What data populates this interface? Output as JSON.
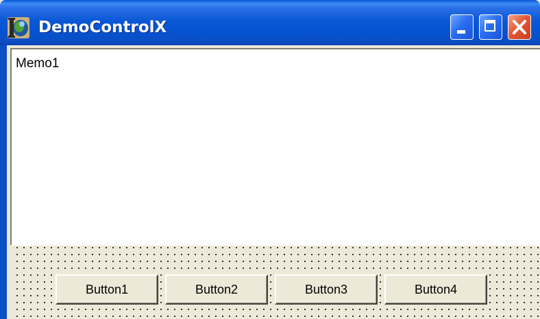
{
  "window": {
    "title": "DemoControlX",
    "app_icon": "delphi-helmet-icon"
  },
  "caption_buttons": {
    "minimize": "minimize-icon",
    "maximize": "maximize-icon",
    "close": "close-icon"
  },
  "memo": {
    "text": "Memo1"
  },
  "panel": {
    "buttons": [
      {
        "label": "Button1"
      },
      {
        "label": "Button2"
      },
      {
        "label": "Button3"
      },
      {
        "label": "Button4"
      }
    ]
  },
  "colors": {
    "titlebar": "#0b58d6",
    "close_button": "#e2593a",
    "form_background": "#ece9d8"
  }
}
